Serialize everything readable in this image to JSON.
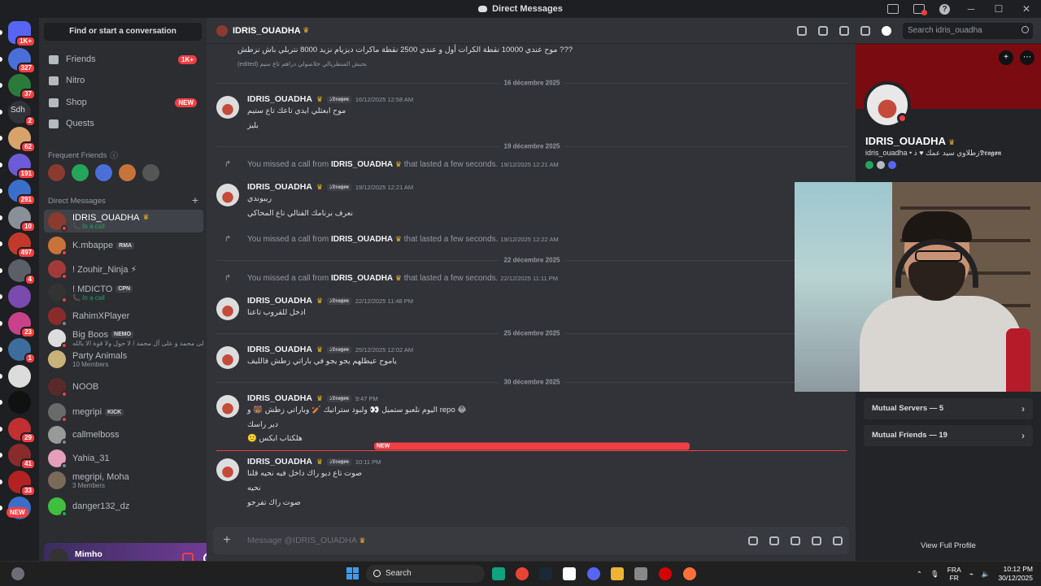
{
  "window": {
    "title": "Direct Messages"
  },
  "rail": {
    "servers": [
      {
        "badge": "1K+",
        "color": "#5865f2"
      },
      {
        "badge": "327",
        "color": "#4a6fd8"
      },
      {
        "badge": "37",
        "color": "#2b7a3a"
      },
      {
        "badge": "2",
        "color": "#313338",
        "label": "Sdh"
      },
      {
        "badge": "62",
        "color": "#d8a36b"
      },
      {
        "badge": "191",
        "color": "#6c5ad6"
      },
      {
        "badge": "291",
        "color": "#3a6fc9"
      },
      {
        "badge": "10",
        "color": "#8a8f98"
      },
      {
        "badge": "497",
        "color": "#c0392b"
      },
      {
        "badge": "4",
        "color": "#5a5f68"
      },
      {
        "badge": "",
        "color": "#7b4ab0"
      },
      {
        "badge": "23",
        "color": "#c8418a"
      },
      {
        "badge": "1",
        "color": "#3c6d9c"
      },
      {
        "badge": "",
        "color": "#dcdcdc"
      },
      {
        "badge": "",
        "color": "#111111"
      },
      {
        "badge": "29",
        "color": "#c03030"
      },
      {
        "badge": "41",
        "color": "#8a2b2b"
      },
      {
        "badge": "33",
        "color": "#b22222"
      },
      {
        "badge": "",
        "color": "#3a6fc9"
      }
    ],
    "new_label": "NEW"
  },
  "sidebar": {
    "find": "Find or start a conversation",
    "nav": [
      {
        "label": "Friends",
        "badge": "1K+"
      },
      {
        "label": "Nitro",
        "badge": ""
      },
      {
        "label": "Shop",
        "badge": "NEW"
      },
      {
        "label": "Quests",
        "badge": ""
      }
    ],
    "frequent_title": "Frequent Friends",
    "dm_title": "Direct Messages",
    "dms": [
      {
        "name": "IDRIS_OUADHA",
        "sub": "In a call",
        "call": true,
        "tag": "",
        "status": "dnd",
        "color": "#8a3a2e",
        "crown": true
      },
      {
        "name": "K.mbappe",
        "sub": "",
        "call": false,
        "tag": "RMA",
        "status": "dnd",
        "color": "#c8733a"
      },
      {
        "name": "! Zouhir_Ninja ⚡",
        "sub": "",
        "call": false,
        "tag": "",
        "status": "dnd",
        "color": "#a33a3a"
      },
      {
        "name": "! MDICTO",
        "sub": "In a call",
        "call": true,
        "tag": "CPN",
        "status": "dnd",
        "color": "#333333"
      },
      {
        "name": "RahimXPlayer",
        "sub": "",
        "call": false,
        "tag": "",
        "status": "off",
        "color": "#8a2b2b"
      },
      {
        "name": "Big Boos",
        "sub": "صل على محمد و على آل محمد / لا حول ولا قوة الا بالله",
        "call": false,
        "tag": "NEMO",
        "status": "dnd",
        "color": "#dddddd"
      },
      {
        "name": "Party Animals",
        "sub": "10 Members",
        "call": false,
        "tag": "",
        "status": "",
        "color": "#c9b27a"
      },
      {
        "name": "NOOB",
        "sub": "",
        "call": false,
        "tag": "",
        "status": "dnd",
        "color": "#5a2a2a"
      },
      {
        "name": "megripi",
        "sub": "",
        "call": false,
        "tag": "KICK",
        "status": "dnd",
        "color": "#6a6a6a"
      },
      {
        "name": "callmelboss",
        "sub": "",
        "call": false,
        "tag": "",
        "status": "off",
        "color": "#999999"
      },
      {
        "name": "Yahia_31",
        "sub": "",
        "call": false,
        "tag": "",
        "status": "off",
        "color": "#e3a0b8"
      },
      {
        "name": "megripi, Moha",
        "sub": "3 Members",
        "call": false,
        "tag": "",
        "status": "",
        "color": "#7a6a5a"
      },
      {
        "name": "danger132_dz",
        "sub": "",
        "call": false,
        "tag": "",
        "status": "on",
        "color": "#3fbf3f"
      }
    ]
  },
  "user": {
    "name": "Mimho",
    "handle": "mimho"
  },
  "header": {
    "name": "IDRIS_OUADHA",
    "search_placeholder": "Search idris_ouadha"
  },
  "chat": {
    "top_lines": [
      "موح عندي 10000 نقطة الكرات أول و عندي 2500 نقطة ماكرات ديزيام نزيد 8000 نتربلي باش نزطش ???",
      "(edited)  نحبش المنطريالي خلاصولي دراهم تاع سيم"
    ],
    "dividers": [
      "16 décembre 2025",
      "19 décembre 2025",
      "22 décembre 2025",
      "25 décembre 2025",
      "30 décembre 2025"
    ],
    "author": "IDRIS_OUADHA",
    "clan": "ذ𝕯𝖗𝖆𝖌𝖔𝖓",
    "messages": [
      {
        "time": "16/12/2025 12:58 AM",
        "lines": [
          "موح ابعثلي ايدي تاعك تاع ستيم",
          "بليز"
        ]
      },
      {
        "time": "19/12/2025 12:21 AM",
        "lines": [
          "ريبوندي",
          "نعرف برنامك الفتالي تاع المحاكي"
        ]
      },
      {
        "time": "22/12/2025 11:48 PM",
        "lines": [
          "ادخل للقروب تاعنا"
        ]
      },
      {
        "time": "25/12/2025 12:02 AM",
        "lines": [
          "ياموح عيطلهم يجو يجو في باراتي زطش فالليف"
        ]
      },
      {
        "time": "9:47 PM",
        "lines": [
          "اليوم نلعبو ستميل 👀   ولبود ستراتيك 🏏 وباراتي زطش 🐻 و repo 😂",
          "دير راسك",
          "🙁 هلكتاب ايكس"
        ]
      },
      {
        "time": "10:11 PM",
        "lines": [
          "صوت تاع ديو راك داخل فيه نحيه قلنا",
          "نحيه",
          "صوت راك تفرجو"
        ]
      }
    ],
    "system": [
      {
        "pre": "You missed a call from",
        "who": "IDRIS_OUADHA",
        "post": "that lasted a few seconds.",
        "time": "19/12/2025 12:21 AM"
      },
      {
        "pre": "You missed a call from",
        "who": "IDRIS_OUADHA",
        "post": "that lasted a few seconds.",
        "time": "19/12/2025 12:22 AM"
      },
      {
        "pre": "You missed a call from",
        "who": "IDRIS_OUADHA",
        "post": "that lasted a few seconds.",
        "time": "22/12/2025 11:11 PM"
      }
    ],
    "new_label": "NEW",
    "composer_placeholder": "Message @IDRIS_OUADHA"
  },
  "profile": {
    "name": "IDRIS_OUADHA",
    "sub": "idris_ouadha • زطلاوي سيد عمك  ♥  ذ𝕯𝖗𝖆𝖌𝖔𝖓",
    "mutual_servers": "Mutual Servers — 5",
    "mutual_friends": "Mutual Friends — 19",
    "full": "View Full Profile"
  },
  "taskbar": {
    "search": "Search",
    "lang1": "FRA",
    "lang2": "FR",
    "time": "10:12 PM",
    "date": "30/12/2025"
  },
  "colors": {
    "accent": "#5865f2",
    "danger": "#f23f43",
    "online": "#23a55a",
    "banner": "#7a0b10"
  }
}
